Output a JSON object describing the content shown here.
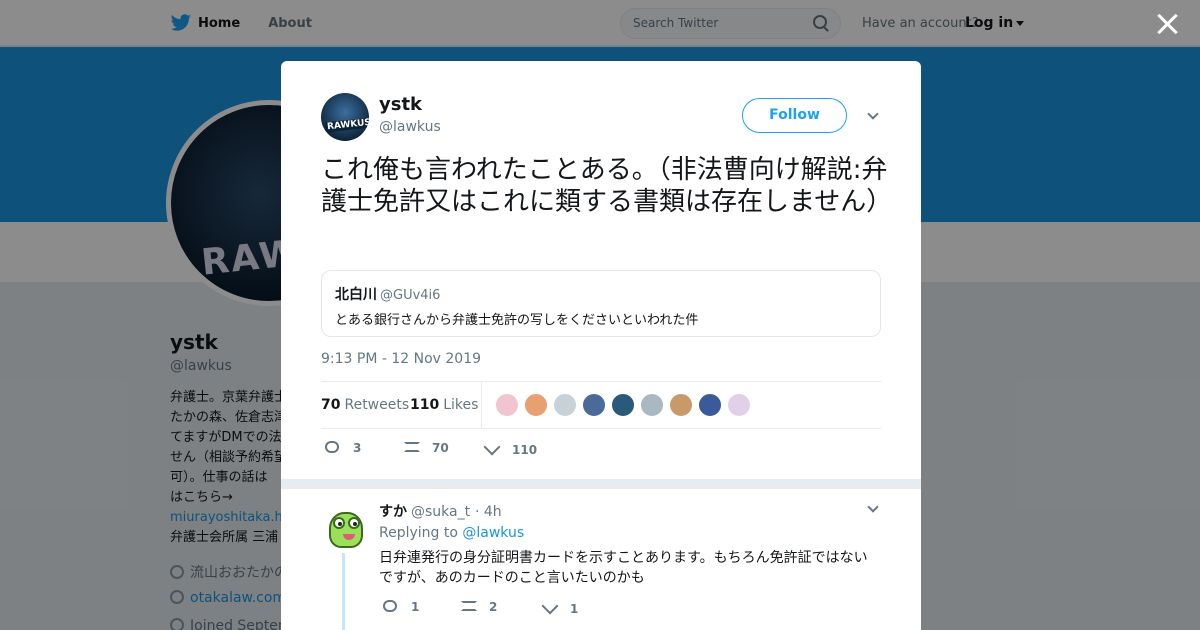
{
  "nav": {
    "home_label": "Home",
    "about_label": "About",
    "search_placeholder": "Search Twitter",
    "have_account": "Have an account?",
    "login_label": "Log in"
  },
  "profile": {
    "name": "ystk",
    "handle": "@lawkus",
    "bio_lines": [
      "弁護士。京葉弁護士",
      "たかの森、佐倉志津",
      "てますがDMでの法律",
      "せん（相談予約希望",
      "可）。仕事の話は",
      "はこちら→"
    ],
    "bio_link": "miurayoshitaka.hatenablog.com",
    "bio_last": "弁護士会所属 三浦",
    "location": "流山おおたかの森",
    "website": "otakalaw.com",
    "joined": "Joined September"
  },
  "tweet": {
    "avatar_text": "RAWKUS",
    "name": "ystk",
    "handle": "@lawkus",
    "follow_label": "Follow",
    "text": "これ俺も言われたことある。（非法曹向け解説:弁護士免許又はこれに類する書類は存在しません）",
    "quote": {
      "name": "北白川",
      "handle": "@GUv4i6",
      "text": "とある銀行さんから弁護士免許の写しをくださいといわれた件"
    },
    "timestamp": "9:13 PM - 12 Nov 2019",
    "retweets_count": "70",
    "retweets_label": "Retweets",
    "likes_count": "110",
    "likes_label": "Likes",
    "actions": {
      "reply": "3",
      "retweet": "70",
      "like": "110"
    },
    "liker_colors": [
      "#f2c4d0",
      "#e8a070",
      "#c8d0d8",
      "#4a6a9a",
      "#2a5a7a",
      "#aab8c2",
      "#c89a6a",
      "#3a5a9a",
      "#e0d0e8"
    ]
  },
  "reply": {
    "name": "すか",
    "handle": "@suka_t",
    "time": "· 4h",
    "replying_prefix": "Replying to",
    "replying_to": "@lawkus",
    "text": "日弁連発行の身分証明書カードを示すことあります。もちろん免許証ではないですが、あのカードのこと言いたいのかも",
    "actions": {
      "reply": "1",
      "retweet": "2",
      "like": "1"
    }
  }
}
